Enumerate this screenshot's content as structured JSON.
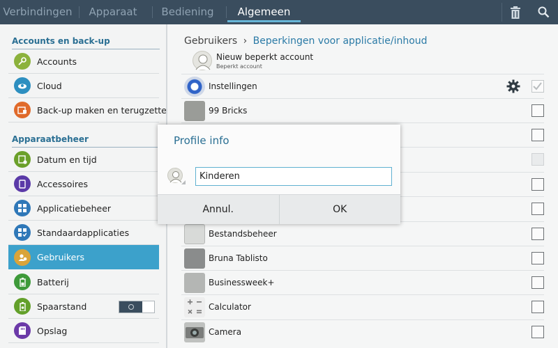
{
  "tabs": [
    {
      "label": "Verbindingen",
      "active": false
    },
    {
      "label": "Apparaat",
      "active": false
    },
    {
      "label": "Bediening",
      "active": false
    },
    {
      "label": "Algemeen",
      "active": true
    }
  ],
  "toolbar": {
    "icons": [
      "trash-icon",
      "search-icon"
    ]
  },
  "sidebar": {
    "sections": [
      {
        "title": "Accounts en back-up"
      },
      {
        "title": "Apparaatbeheer"
      }
    ],
    "items": [
      {
        "label": "Accounts",
        "icon": "key-icon",
        "color": "#8cb23c"
      },
      {
        "label": "Cloud",
        "icon": "cloud-icon",
        "color": "#2d8fc0"
      },
      {
        "label": "Back-up maken en terugzetten",
        "icon": "backup-icon",
        "color": "#e06a2a"
      },
      {
        "label": "Datum en tijd",
        "icon": "calendar-clock-icon",
        "color": "#6ba02a"
      },
      {
        "label": "Accessoires",
        "icon": "accessory-icon",
        "color": "#5b3aa8"
      },
      {
        "label": "Applicatiebeheer",
        "icon": "apps-icon",
        "color": "#2f78b8"
      },
      {
        "label": "Standaardapplicaties",
        "icon": "default-apps-icon",
        "color": "#2f78b8"
      },
      {
        "label": "Gebruikers",
        "icon": "users-icon",
        "color": "#d9a43a",
        "selected": true
      },
      {
        "label": "Batterij",
        "icon": "battery-icon",
        "color": "#3e9a3a"
      },
      {
        "label": "Spaarstand",
        "icon": "power-saving-icon",
        "color": "#63a02a",
        "toggle": false
      },
      {
        "label": "Opslag",
        "icon": "storage-icon",
        "color": "#6c3aa8"
      }
    ]
  },
  "breadcrumb": {
    "parent": "Gebruikers",
    "separator": "›",
    "current": "Beperkingen voor applicatie/inhoud"
  },
  "account": {
    "name": "Nieuw beperkt account",
    "type": "Beperkt account"
  },
  "apps": [
    {
      "label": "Instellingen",
      "icon": "settings-app-icon",
      "state": "checked",
      "gear": true
    },
    {
      "label": "99 Bricks",
      "icon": "bricks-app-icon",
      "state": "unchecked"
    },
    {
      "label": "",
      "icon": "",
      "state": "unchecked"
    },
    {
      "label": "",
      "icon": "",
      "state": "disabled"
    },
    {
      "label": "",
      "icon": "",
      "state": "unchecked"
    },
    {
      "label": "",
      "icon": "",
      "state": "unchecked"
    },
    {
      "label": "Bestandsbeheer",
      "icon": "file-manager-app-icon",
      "state": "unchecked"
    },
    {
      "label": "Bruna Tablisto",
      "icon": "bruna-app-icon",
      "state": "unchecked"
    },
    {
      "label": "Businessweek+",
      "icon": "businessweek-app-icon",
      "state": "unchecked"
    },
    {
      "label": "Calculator",
      "icon": "calculator-app-icon",
      "state": "unchecked"
    },
    {
      "label": "Camera",
      "icon": "camera-app-icon",
      "state": "unchecked"
    }
  ],
  "dialog": {
    "title": "Profile info",
    "input_value": "Kinderen",
    "cancel_label": "Annul.",
    "ok_label": "OK"
  },
  "colors": {
    "topbar": "#3a4d5e",
    "accent": "#3ca1cb",
    "title_blue": "#2a6f93"
  }
}
